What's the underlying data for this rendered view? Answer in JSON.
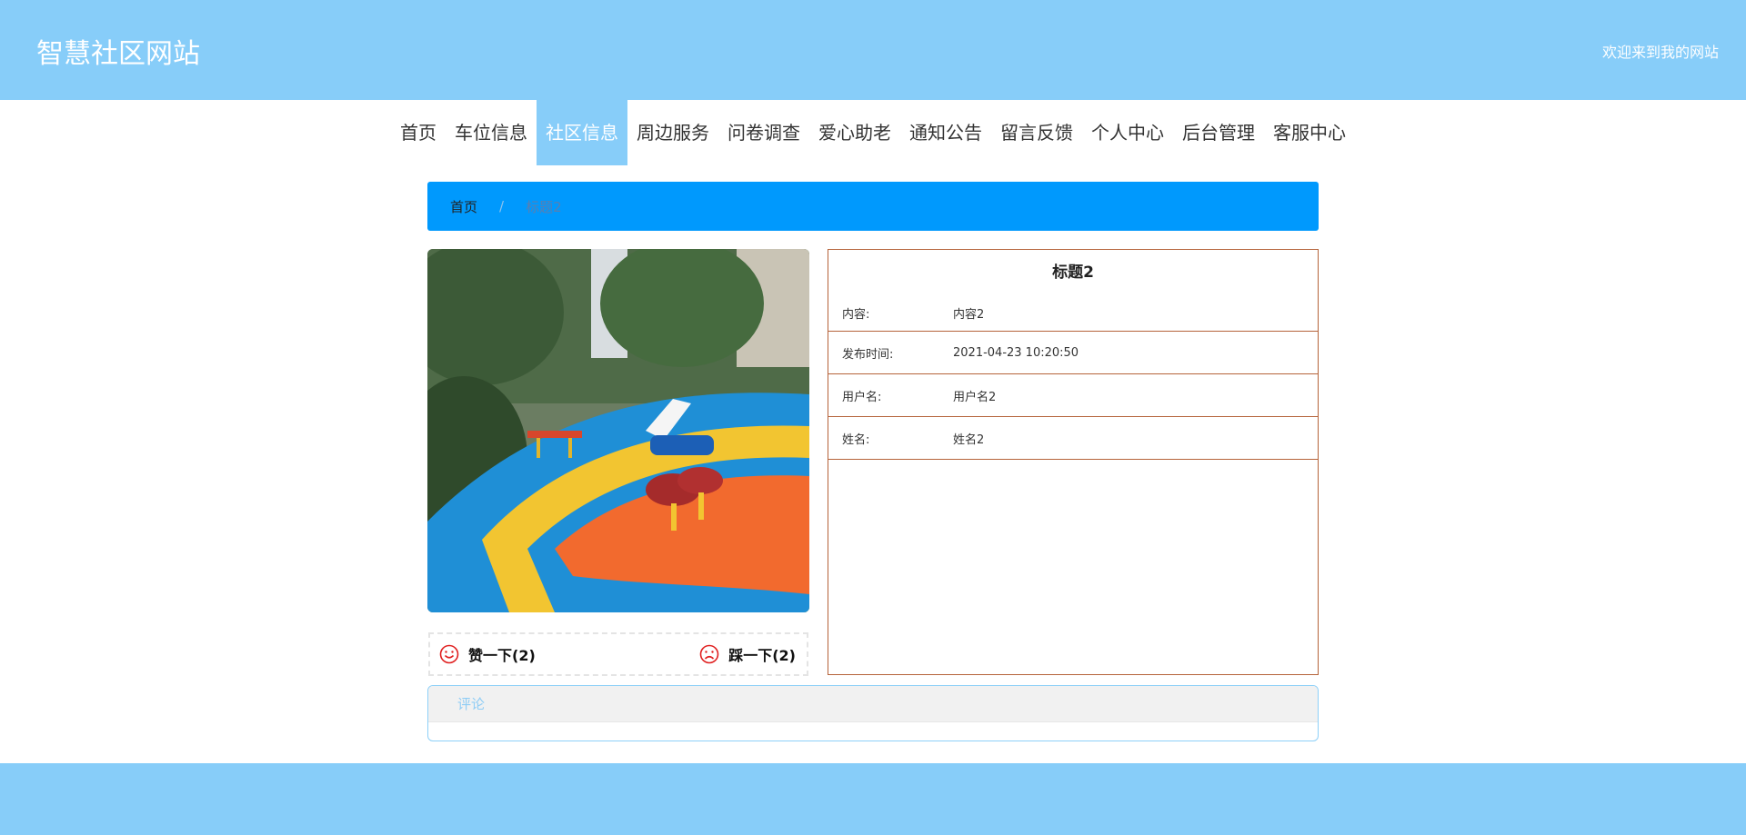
{
  "header": {
    "site_title": "智慧社区网站",
    "welcome": "欢迎来到我的网站"
  },
  "nav": {
    "items": [
      {
        "label": "首页"
      },
      {
        "label": "车位信息"
      },
      {
        "label": "社区信息",
        "active": true
      },
      {
        "label": "周边服务"
      },
      {
        "label": "问卷调查"
      },
      {
        "label": "爱心助老"
      },
      {
        "label": "通知公告"
      },
      {
        "label": "留言反馈"
      },
      {
        "label": "个人中心"
      },
      {
        "label": "后台管理"
      },
      {
        "label": "客服中心"
      }
    ]
  },
  "breadcrumb": {
    "home": "首页",
    "separator": "/",
    "current": "标题2"
  },
  "votes": {
    "like": "赞一下(2)",
    "dislike": "踩一下(2)"
  },
  "detail": {
    "title": "标题2",
    "rows": [
      {
        "label": "内容:",
        "value": "内容2"
      },
      {
        "label": "发布时间:",
        "value": "2021-04-23 10:20:50"
      },
      {
        "label": "用户名:",
        "value": "用户名2"
      },
      {
        "label": "姓名:",
        "value": "姓名2"
      }
    ]
  },
  "comment": {
    "title": "评论"
  },
  "colors": {
    "primary": "#87cdf9",
    "breadcrumb_bg": "#0099fd",
    "detail_border": "#b5633a",
    "vote_icon": "#e02020"
  },
  "icons": {
    "like": "smile-icon",
    "dislike": "frown-icon"
  }
}
